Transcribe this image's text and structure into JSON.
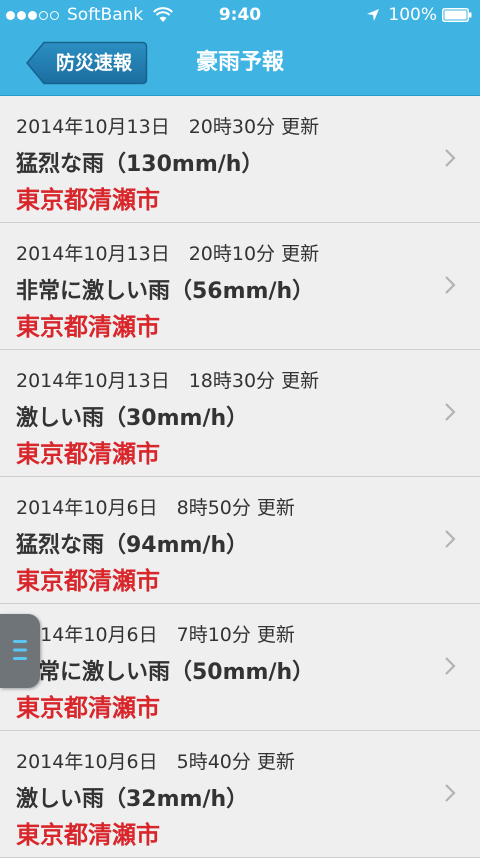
{
  "status_bar": {
    "carrier": "SoftBank",
    "time": "9:40",
    "battery": "100%",
    "signal_dots_filled": 3,
    "signal_dots_total": 5,
    "icons": [
      "wifi-icon",
      "location-arrow-icon",
      "battery-icon"
    ]
  },
  "nav": {
    "back_label": "防災速報",
    "title": "豪雨予報"
  },
  "items": [
    {
      "date": "2014年10月13日　20時30分 更新",
      "title": "猛烈な雨（130mm/h）",
      "location": "東京都清瀬市"
    },
    {
      "date": "2014年10月13日　20時10分 更新",
      "title": "非常に激しい雨（56mm/h）",
      "location": "東京都清瀬市"
    },
    {
      "date": "2014年10月13日　18時30分 更新",
      "title": "激しい雨（30mm/h）",
      "location": "東京都清瀬市"
    },
    {
      "date": "2014年10月6日　8時50分 更新",
      "title": "猛烈な雨（94mm/h）",
      "location": "東京都清瀬市"
    },
    {
      "date": "2014年10月6日　7時10分 更新",
      "title": "非常に激しい雨（50mm/h）",
      "location": "東京都清瀬市"
    },
    {
      "date": "2014年10月6日　5時40分 更新",
      "title": "激しい雨（32mm/h）",
      "location": "東京都清瀬市"
    }
  ],
  "colors": {
    "header": "#3fb4e3",
    "location_text": "#d8262b",
    "row_background": "#efefef"
  }
}
